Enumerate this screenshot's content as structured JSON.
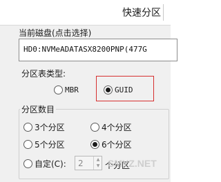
{
  "window": {
    "title": "快速分区"
  },
  "disk": {
    "label": "当前磁盘(点击选择)",
    "value": "HD0:NVMeADATASX8200PNP(477G"
  },
  "partition_table": {
    "label": "分区表类型:",
    "options": [
      {
        "label": "MBR",
        "selected": false
      },
      {
        "label": "GUID",
        "selected": true
      }
    ],
    "highlight_color": "#d62e2e"
  },
  "partition_count": {
    "label": "分区数目",
    "options": [
      {
        "label": "3个分区",
        "selected": false
      },
      {
        "label": "4个分区",
        "selected": false
      },
      {
        "label": "5个分区",
        "selected": false
      },
      {
        "label": "6个分区",
        "selected": true
      }
    ],
    "custom": {
      "label": "自定(C):",
      "value": "2",
      "suffix": "个分区",
      "selected": false
    }
  },
  "watermark": "SMYZ.NET"
}
